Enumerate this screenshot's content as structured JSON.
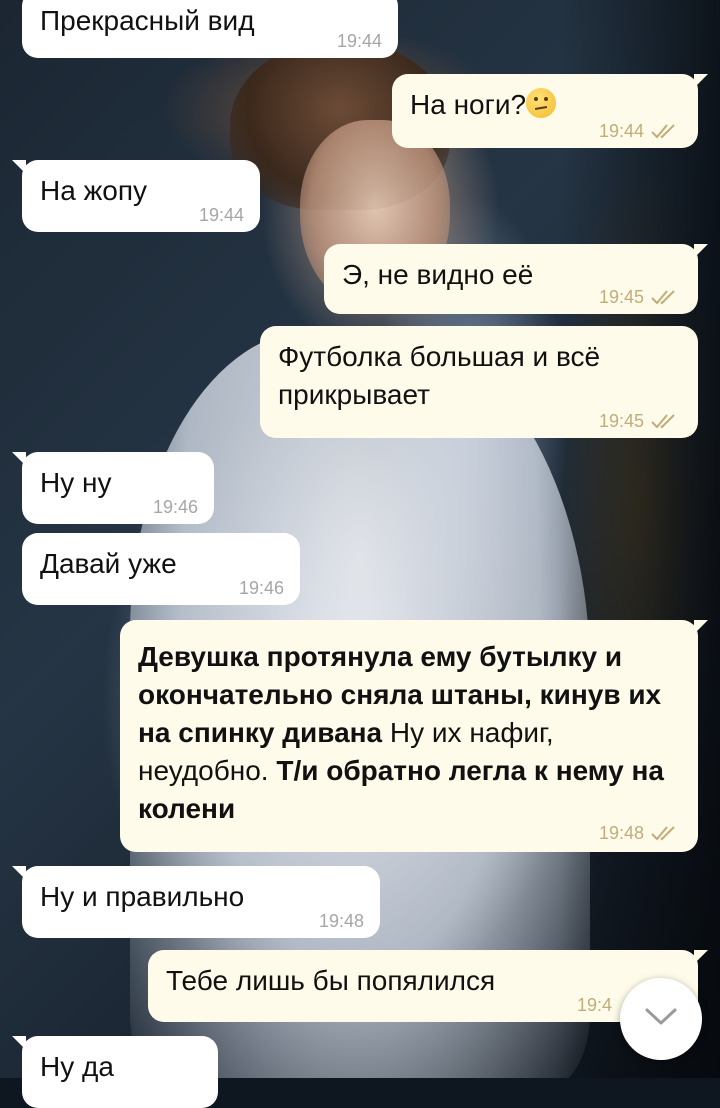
{
  "messages": [
    {
      "text": "Прекрасный вид",
      "time": "19:44"
    },
    {
      "text": "На ноги?",
      "time": "19:44",
      "emoji": "raised-eyebrow-emoji"
    },
    {
      "text": "На жопу",
      "time": "19:44"
    },
    {
      "text": "Э, не видно её",
      "time": "19:45"
    },
    {
      "text_line1": "Футболка большая и всё",
      "text_line2": "прикрывает",
      "time": "19:45"
    },
    {
      "text": "Ну ну",
      "time": "19:46"
    },
    {
      "text": "Давай уже",
      "time": "19:46"
    },
    {
      "part1": "Девушка протянула ему бутылку и окончательно сняла штаны, кинув их на спинку дивана",
      "part2": " Ну их нафиг, неудобно. ",
      "part3": "Т/и обратно легла к нему на колени",
      "time": "19:48"
    },
    {
      "text": "Ну и правильно",
      "time": "19:48"
    },
    {
      "text": "Тебе лишь бы попялился",
      "time": "19:4"
    },
    {
      "text": "Ну да"
    }
  ],
  "icons": {
    "read_receipt": "double-check-icon",
    "scroll_down": "chevron-down-icon"
  },
  "colors": {
    "incoming_bubble": "#ffffff",
    "outgoing_bubble": "#fffbea",
    "outgoing_time": "#c1ad7a",
    "incoming_time": "#a6a6a6"
  }
}
